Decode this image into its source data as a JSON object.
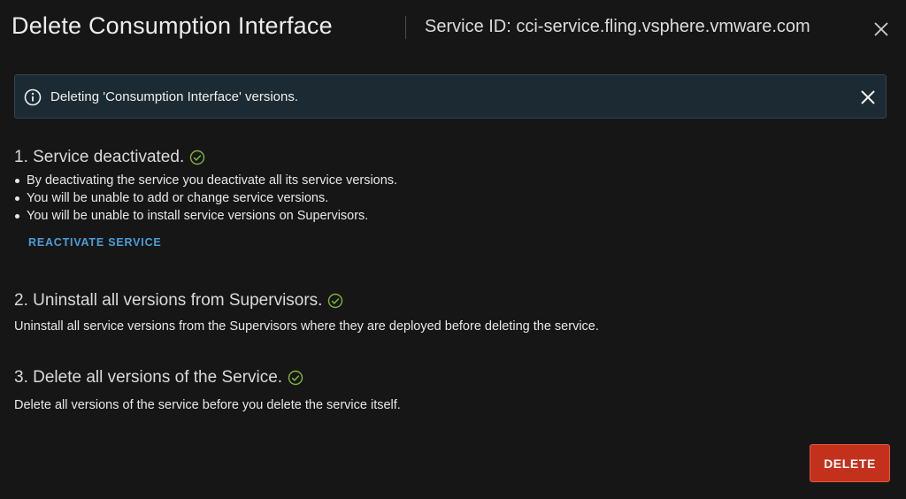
{
  "header": {
    "title": "Delete Consumption Interface",
    "subtitle": "Service ID: cci-service.fling.vsphere.vmware.com",
    "close_icon": "close-icon"
  },
  "alert": {
    "icon": "info-icon",
    "message": "Deleting 'Consumption Interface' versions.",
    "close_icon": "close-icon"
  },
  "steps": [
    {
      "heading": "1. Service deactivated.",
      "status_icon": "check-circle-icon",
      "bullets": [
        "By deactivating the service you deactivate all its service versions.",
        "You will be unable to add or change service versions.",
        "You will be unable to install service versions on Supervisors."
      ],
      "action_label": "REACTIVATE SERVICE"
    },
    {
      "heading": "2. Uninstall all versions from Supervisors.",
      "status_icon": "check-circle-icon",
      "description": "Uninstall all service versions from the Supervisors where they are deployed before deleting the service."
    },
    {
      "heading": "3. Delete all versions of the Service.",
      "status_icon": "check-circle-icon",
      "description": "Delete all versions of the service before you delete the service itself."
    }
  ],
  "footer": {
    "delete_label": "DELETE"
  },
  "colors": {
    "background": "#161616",
    "alert_background": "#1c2a33",
    "link": "#4a9fd8",
    "success": "#7fb53a",
    "danger": "#c3311d"
  }
}
